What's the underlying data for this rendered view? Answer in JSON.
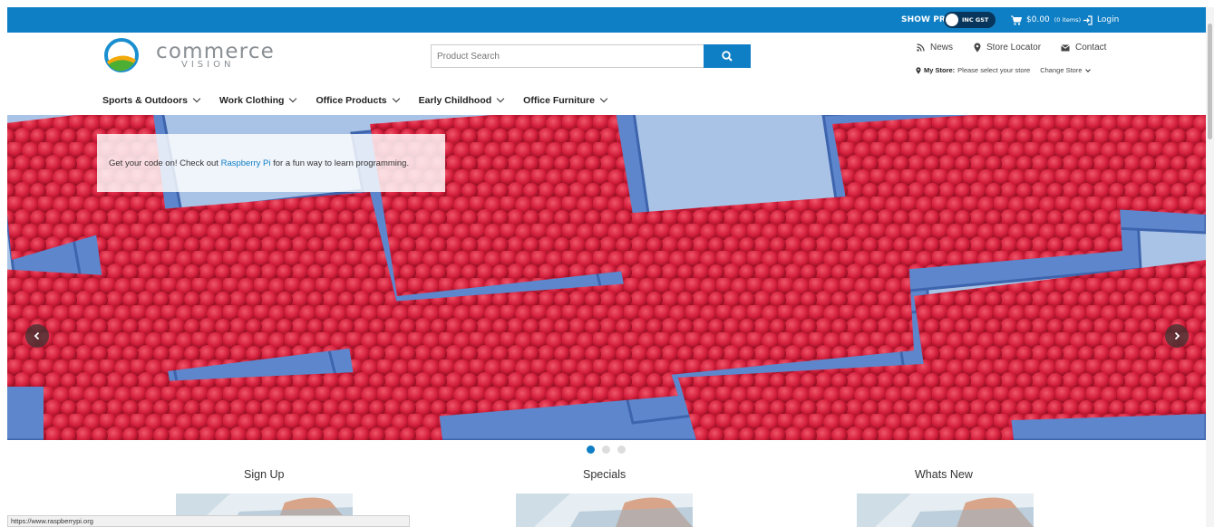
{
  "topbar": {
    "show_prices": "SHOW PRICES",
    "gst_toggle": "INC GST",
    "cart_total": "$0.00",
    "cart_items": "(0 items)",
    "login": "Login"
  },
  "header": {
    "logo_word": "commerce",
    "logo_sub": "VISION",
    "search_placeholder": "Product Search",
    "links": {
      "news": "News",
      "store_locator": "Store Locator",
      "contact": "Contact"
    },
    "my_store_label": "My Store:",
    "my_store_value": "Please select your store",
    "change_store": "Change Store"
  },
  "nav": [
    {
      "label": "Sports & Outdoors"
    },
    {
      "label": "Work Clothing"
    },
    {
      "label": "Office Products"
    },
    {
      "label": "Early Childhood"
    },
    {
      "label": "Office Furniture"
    }
  ],
  "hero": {
    "callout_prefix": "Get your code on! Check out ",
    "callout_link": "Raspberry Pi",
    "callout_suffix": " for a fun way to learn programming.",
    "slide_index": 1,
    "slide_count": 3
  },
  "sections": {
    "signup": "Sign Up",
    "specials": "Specials",
    "whats_new": "Whats New"
  },
  "statusbar": {
    "url": "https://www.raspberrypi.org"
  },
  "colors": {
    "brand_blue": "#0f7fc5",
    "toggle_bg": "#08355b"
  }
}
